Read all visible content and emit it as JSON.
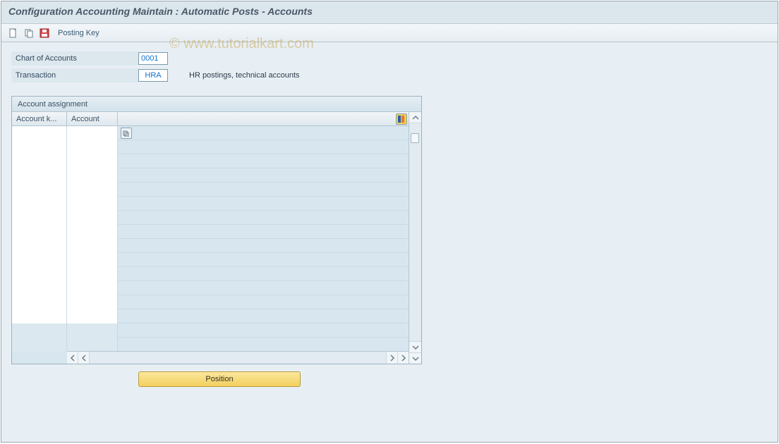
{
  "title": "Configuration Accounting Maintain : Automatic Posts - Accounts",
  "toolbar": {
    "new_icon": "new-icon",
    "copy_icon": "copy-icon",
    "save_icon": "save-icon",
    "posting_key": "Posting Key"
  },
  "fields": {
    "coa_label": "Chart of Accounts",
    "coa_value": "0001",
    "tx_label": "Transaction",
    "tx_value": "HRA",
    "tx_desc": "HR postings, technical accounts"
  },
  "panel": {
    "title": "Account assignment",
    "columns": {
      "c1": "Account k...",
      "c2": "Account"
    }
  },
  "buttons": {
    "position": "Position"
  },
  "watermark": "© www.tutorialkart.com"
}
